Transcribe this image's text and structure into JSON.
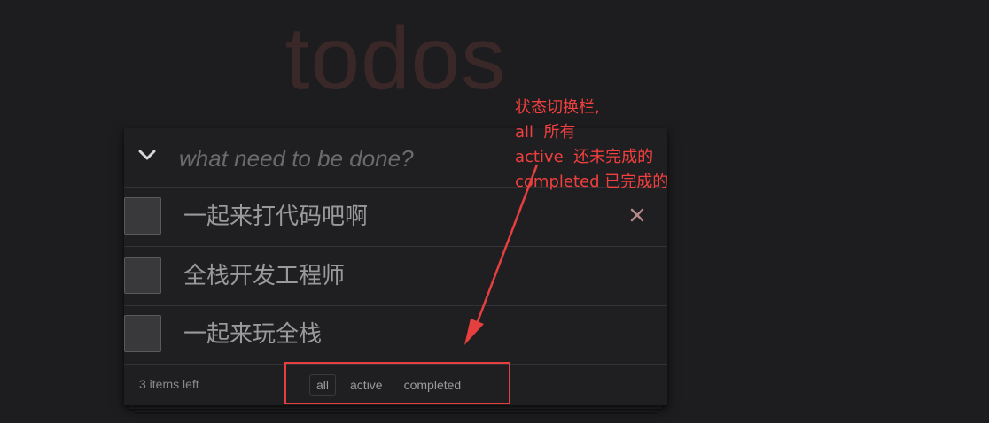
{
  "app_title": "todos",
  "new_todo": {
    "placeholder": "what need to be done?"
  },
  "todos": [
    {
      "label": "一起来打代码吧啊",
      "completed": false
    },
    {
      "label": "全栈开发工程师",
      "completed": false
    },
    {
      "label": "一起来玩全栈",
      "completed": false
    }
  ],
  "footer": {
    "items_left": "3 items left",
    "filters": [
      "all",
      "active",
      "completed"
    ],
    "selected_filter": "all"
  },
  "annotation": {
    "lines": [
      "状态切换栏,",
      "all  所有",
      "active  还未完成的",
      "completed 已完成的"
    ],
    "color": "#f23f3f"
  },
  "icons": {
    "toggle_all": "chevron-down-icon",
    "destroy": "close-icon"
  },
  "colors": {
    "background": "#1d1d1f",
    "title": "#3a2727",
    "destroy": "#b38989",
    "highlight": "#e53f3f"
  }
}
